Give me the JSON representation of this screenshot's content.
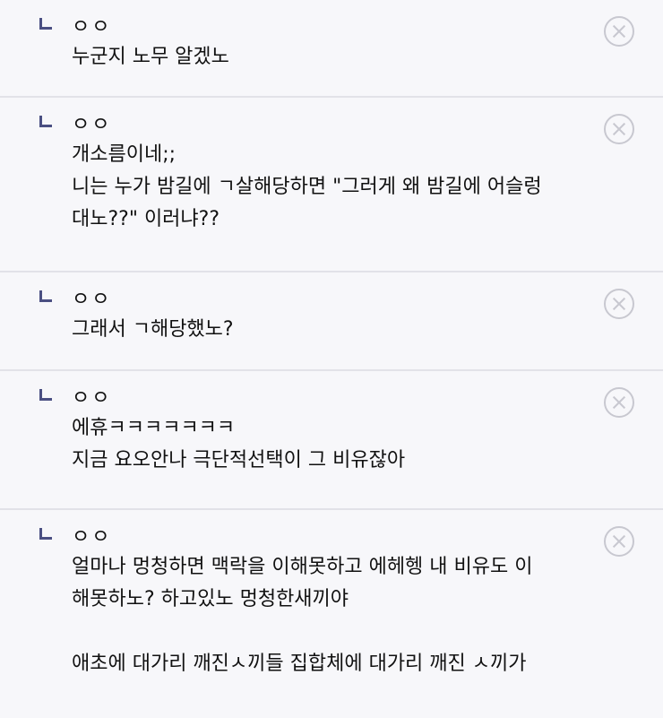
{
  "comments": [
    {
      "author": "ㅇㅇ",
      "lines": [
        "누군지 노무 알겠노"
      ]
    },
    {
      "author": "ㅇㅇ",
      "lines": [
        "개소름이네;;",
        "니는 누가 밤길에 ㄱ살해당하면 \"그러게 왜 밤길에 어슬렁",
        "대노??\" 이러냐??"
      ]
    },
    {
      "author": "ㅇㅇ",
      "lines": [
        "그래서 ㄱ해당했노?"
      ]
    },
    {
      "author": "ㅇㅇ",
      "lines": [
        "에휴ㅋㅋㅋㅋㅋㅋㅋ",
        "지금 요오안나 극단적선택이 그 비유잖아"
      ]
    },
    {
      "author": "ㅇㅇ",
      "lines": [
        "얼마나 멍청하면 맥락을 이해못하고 에헤헹 내 비유도 이",
        "해못하노? 하고있노 멍청한새끼야",
        "",
        "애초에 대가리 깨진ㅅ끼들 집합체에 대가리 깨진 ㅅ끼가"
      ]
    }
  ]
}
